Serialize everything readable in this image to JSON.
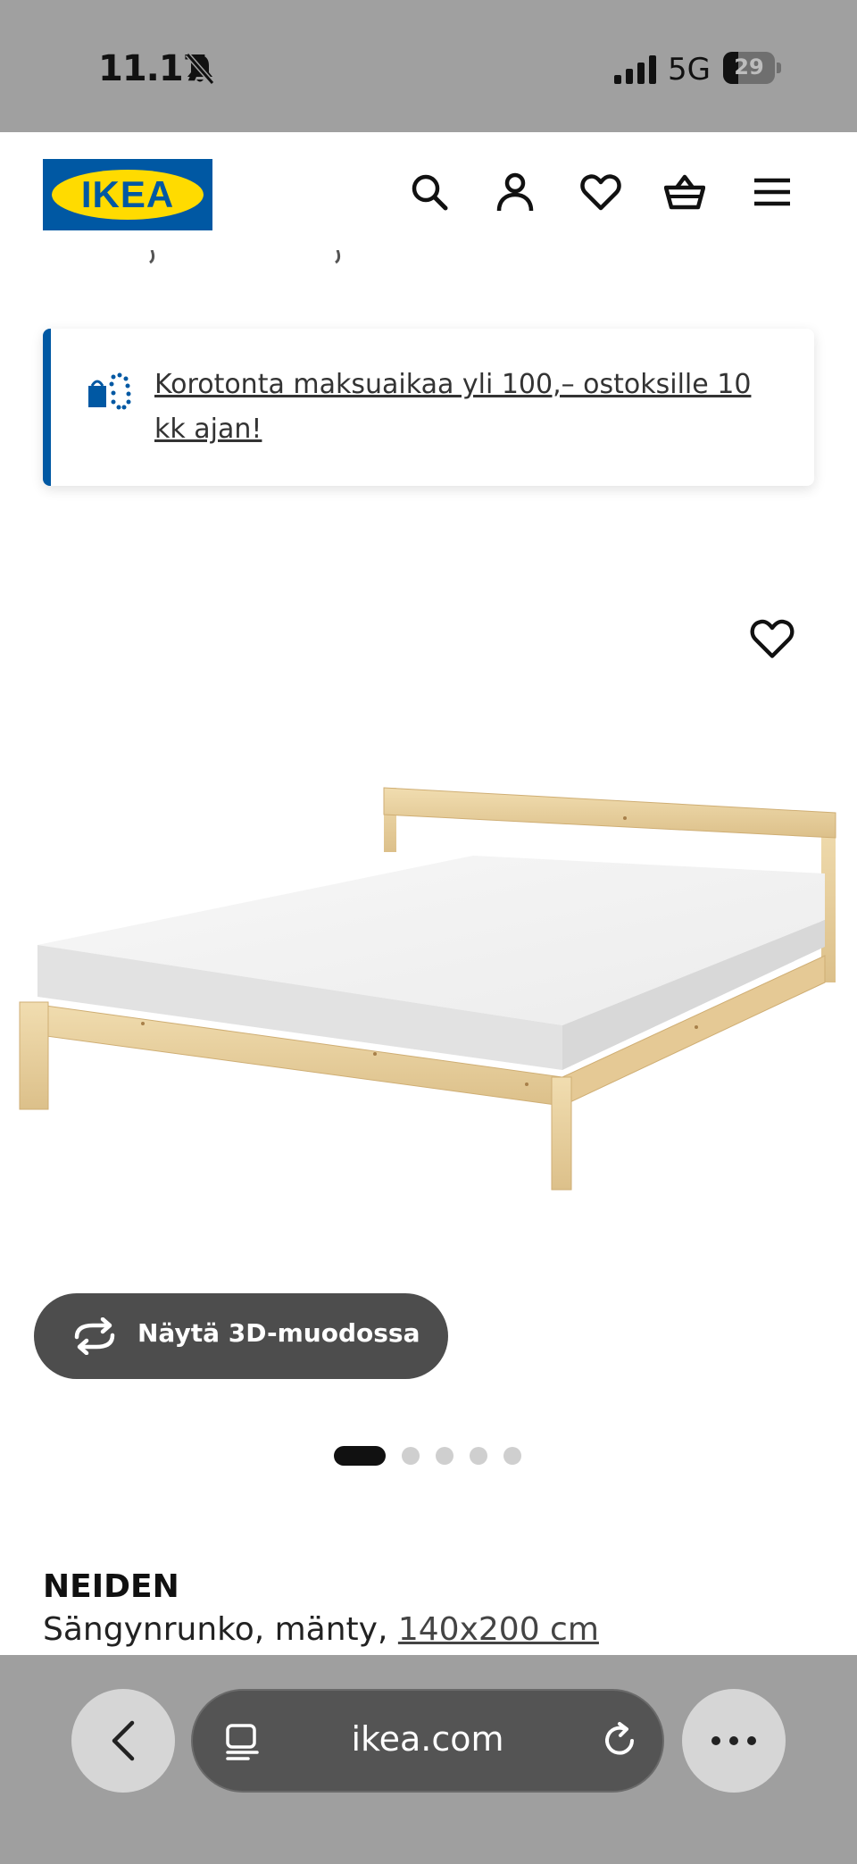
{
  "status_bar": {
    "time": "11.17",
    "network": "5G",
    "battery": "29",
    "battery_level": 0.29
  },
  "header": {
    "logo_text": "IKEA",
    "icons": [
      "search-icon",
      "account-icon",
      "heart-icon",
      "basket-icon",
      "menu-icon"
    ]
  },
  "promo": {
    "text": "Korotonta maksuaikaa yli 100,– ostoksille 10 kk ajan!",
    "accent_color": "#0058a3"
  },
  "product": {
    "view_3d_label": "Näytä 3D-muodossa",
    "name": "NEIDEN",
    "description": "Sängynrunko, mänty, ",
    "size": "140x200 cm",
    "image_count": 5,
    "active_image": 1
  },
  "browser": {
    "url": "ikea.com"
  },
  "colors": {
    "brand_blue": "#0058a3",
    "brand_yellow": "#ffdb00",
    "button_dark": "#4d4d4d"
  }
}
